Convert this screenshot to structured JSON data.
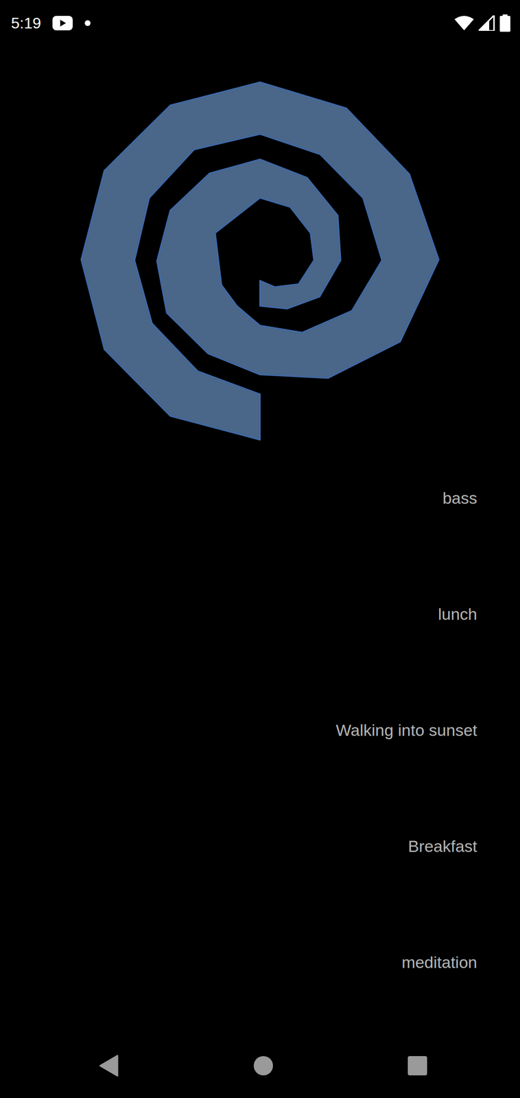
{
  "status_bar": {
    "time": "5:19"
  },
  "list": {
    "items": [
      {
        "label": "bass"
      },
      {
        "label": "lunch"
      },
      {
        "label": "Walking into sunset"
      },
      {
        "label": "Breakfast"
      },
      {
        "label": "meditation"
      }
    ]
  }
}
